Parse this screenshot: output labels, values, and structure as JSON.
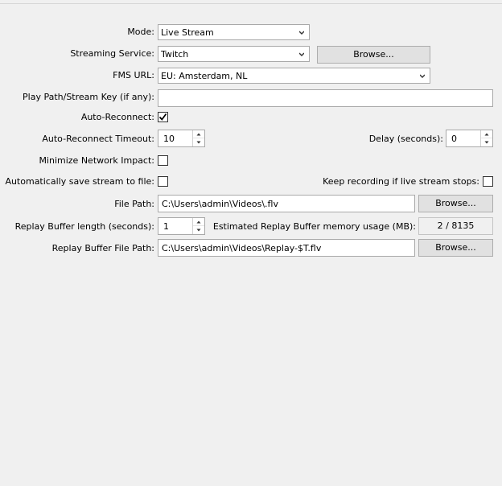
{
  "form": {
    "mode": {
      "label": "Mode:",
      "value": "Live Stream"
    },
    "streaming_service": {
      "label": "Streaming Service:",
      "value": "Twitch",
      "browse": "Browse..."
    },
    "fms_url": {
      "label": "FMS URL:",
      "value": "EU: Amsterdam, NL"
    },
    "play_path": {
      "label": "Play Path/Stream Key (if any):",
      "value": ""
    },
    "auto_reconnect": {
      "label": "Auto-Reconnect:",
      "checked": true
    },
    "auto_reconnect_timeout": {
      "label": "Auto-Reconnect Timeout:",
      "value": "10"
    },
    "delay": {
      "label": "Delay (seconds):",
      "value": "0"
    },
    "minimize_network_impact": {
      "label": "Minimize Network Impact:",
      "checked": false
    },
    "auto_save": {
      "label": "Automatically save stream to file:",
      "checked": false
    },
    "keep_recording": {
      "label": "Keep recording if live stream stops:",
      "checked": false
    },
    "file_path": {
      "label": "File Path:",
      "value": "C:\\Users\\admin\\Videos\\.flv",
      "browse": "Browse..."
    },
    "replay_buffer_length": {
      "label": "Replay Buffer length (seconds):",
      "value": "1"
    },
    "replay_memory": {
      "label": "Estimated Replay Buffer memory usage (MB):",
      "value": "2 / 8135"
    },
    "replay_file_path": {
      "label": "Replay Buffer File Path:",
      "value": "C:\\Users\\admin\\Videos\\Replay-$T.flv",
      "browse": "Browse..."
    }
  }
}
